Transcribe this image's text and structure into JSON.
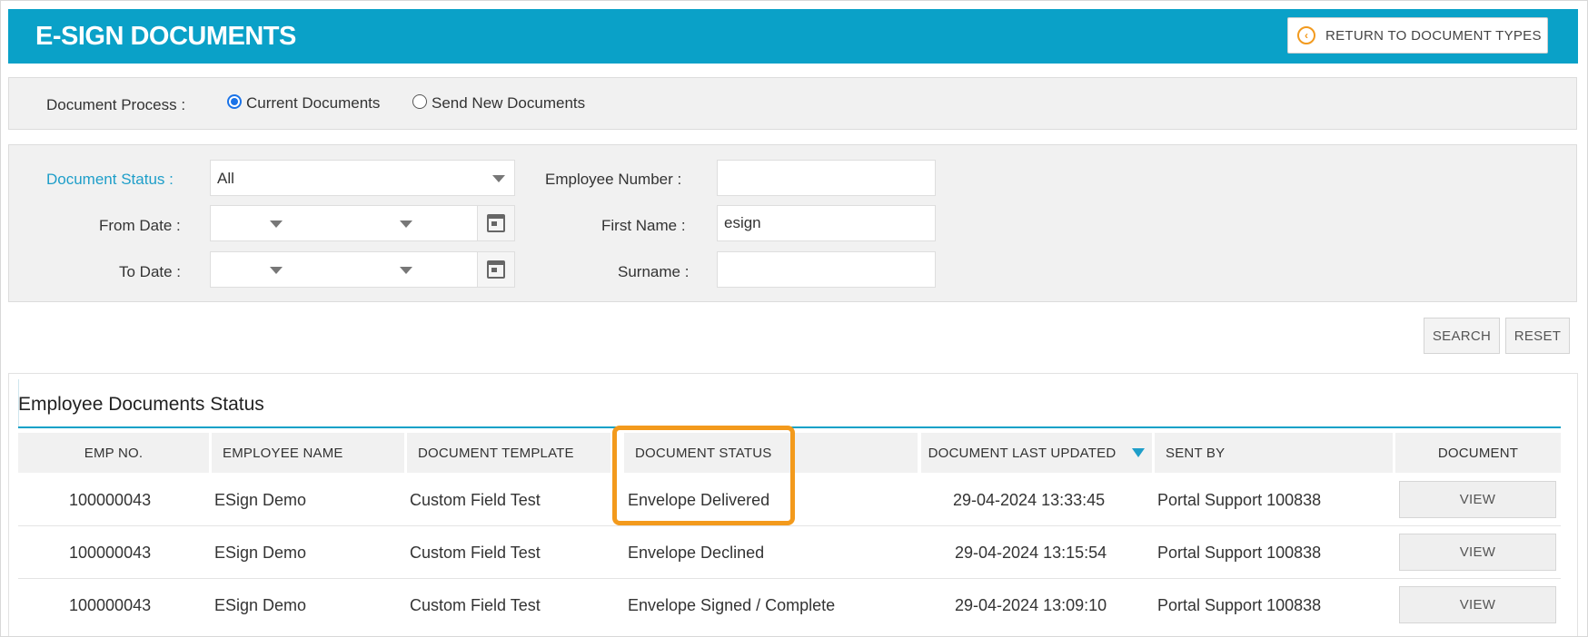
{
  "header": {
    "title": "E-SIGN DOCUMENTS",
    "return_label": "RETURN TO DOCUMENT TYPES",
    "return_icon": "chevron-left-circle-icon",
    "color": "#0aa1c8"
  },
  "process": {
    "label": "Document Process :",
    "options": [
      "Current Documents",
      "Send New Documents"
    ],
    "selected": "Current Documents"
  },
  "filters": {
    "document_status_label": "Document Status :",
    "document_status_value": "All",
    "from_date_label": "From Date :",
    "to_date_label": "To Date :",
    "employee_number_label": "Employee Number :",
    "employee_number_value": "",
    "first_name_label": "First Name :",
    "first_name_value": "esign",
    "surname_label": "Surname :",
    "surname_value": "",
    "accent_color": "#1e9ec9"
  },
  "actions": {
    "search_label": "SEARCH",
    "reset_label": "RESET"
  },
  "documents": {
    "title": "Employee Documents Status",
    "columns": [
      "EMP NO.",
      "EMPLOYEE NAME",
      "DOCUMENT TEMPLATE",
      "DOCUMENT STATUS",
      "DOCUMENT LAST UPDATED",
      "SENT BY",
      "DOCUMENT"
    ],
    "sorted_column": "DOCUMENT LAST UPDATED",
    "view_label": "VIEW",
    "rows": [
      {
        "emp_no": "100000043",
        "name": "ESign Demo",
        "template": "Custom Field Test",
        "status": "Envelope Delivered",
        "updated": "29-04-2024 13:33:45",
        "sent_by": "Portal Support 100838"
      },
      {
        "emp_no": "100000043",
        "name": "ESign Demo",
        "template": "Custom Field Test",
        "status": "Envelope Declined",
        "updated": "29-04-2024 13:15:54",
        "sent_by": "Portal Support 100838"
      },
      {
        "emp_no": "100000043",
        "name": "ESign Demo",
        "template": "Custom Field Test",
        "status": "Envelope Signed / Complete",
        "updated": "29-04-2024 13:09:10",
        "sent_by": "Portal Support 100838"
      }
    ],
    "highlight_color": "#f39a1c"
  }
}
